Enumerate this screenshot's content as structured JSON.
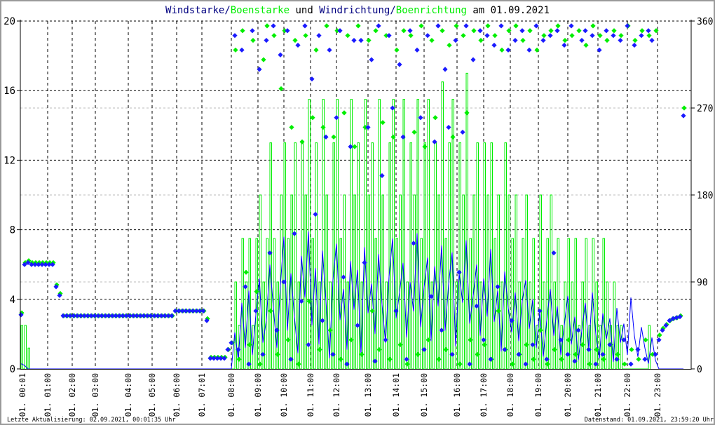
{
  "chart_data": {
    "type": "line+scatter",
    "title_parts": [
      {
        "text": "Windstarke/",
        "color": "#000080"
      },
      {
        "text": "Boenstarke",
        "color": "#00ee00"
      },
      {
        "text": " und ",
        "color": "#000000"
      },
      {
        "text": "Windrichtung/",
        "color": "#000080"
      },
      {
        "text": "Boenrichtung",
        "color": "#00ee00"
      },
      {
        "text": " am 01.09.2021",
        "color": "#000000"
      }
    ],
    "x_range": [
      0,
      190
    ],
    "y_left": {
      "range": [
        0,
        20
      ],
      "ticks": [
        "0",
        "4",
        "8",
        "12",
        "16",
        "20"
      ],
      "values": [
        0,
        4,
        8,
        12,
        16,
        20
      ]
    },
    "y_right": {
      "range": [
        0,
        360
      ],
      "ticks": [
        "0",
        "90",
        "180",
        "270",
        "360"
      ],
      "values": [
        0,
        90,
        180,
        270,
        360
      ]
    },
    "x_ticks": [
      {
        "label": "01. 00:01",
        "index": 0.4
      },
      {
        "label": "01. 01:00",
        "index": 7.6
      },
      {
        "label": "01. 02:00",
        "index": 14.6
      },
      {
        "label": "01. 03:00",
        "index": 21.2
      },
      {
        "label": "01. 04:00",
        "index": 30.6
      },
      {
        "label": "01. 05:00",
        "index": 37.4
      },
      {
        "label": "01. 06:00",
        "index": 44.4
      },
      {
        "label": "01. 07:01",
        "index": 51.6
      },
      {
        "label": "01. 08:00",
        "index": 60
      },
      {
        "label": "01. 09:00",
        "index": 67.6
      },
      {
        "label": "01. 10:00",
        "index": 75
      },
      {
        "label": "01. 11:00",
        "index": 82.6
      },
      {
        "label": "01. 12:00",
        "index": 90
      },
      {
        "label": "01. 13:00",
        "index": 99
      },
      {
        "label": "01. 14:01",
        "index": 107
      },
      {
        "label": "01. 15:00",
        "index": 115
      },
      {
        "label": "01. 16:00",
        "index": 124.4
      },
      {
        "label": "01. 17:00",
        "index": 132
      },
      {
        "label": "01. 18:00",
        "index": 139.6
      },
      {
        "label": "01. 19:00",
        "index": 147.6
      },
      {
        "label": "01. 20:00",
        "index": 156
      },
      {
        "label": "01. 21:00",
        "index": 164.6
      },
      {
        "label": "01. 22:00",
        "index": 173
      },
      {
        "label": "01. 23:00",
        "index": 181.6
      }
    ],
    "series": [
      {
        "name": "Windstarke",
        "axis": "left",
        "kind": "line",
        "color": "#0000ff",
        "values": [
          0.3,
          0.2,
          0,
          0,
          0,
          0,
          0,
          0,
          0,
          0,
          0,
          0,
          0,
          0,
          0,
          0,
          0,
          0,
          0,
          0,
          0,
          0,
          0,
          0,
          0,
          0,
          0,
          0,
          0,
          0,
          0,
          0,
          0,
          0,
          0,
          0,
          0,
          0,
          0,
          0,
          0,
          0,
          0,
          0,
          0,
          0,
          0,
          0,
          0,
          0,
          0,
          0,
          0,
          0,
          0,
          0,
          0,
          0,
          0,
          0,
          0,
          2.1,
          0.5,
          3.8,
          1.2,
          4.5,
          0.8,
          3.1,
          5.2,
          1.5,
          2.8,
          6.0,
          3.5,
          1.2,
          4.8,
          7.6,
          2.2,
          5.5,
          3.0,
          0.9,
          6.5,
          4.1,
          7.9,
          2.5,
          5.8,
          1.4,
          6.8,
          3.9,
          0.6,
          5.1,
          7.2,
          2.8,
          4.6,
          1.1,
          6.2,
          3.4,
          5.7,
          0.8,
          7.0,
          3.2,
          4.9,
          2.0,
          6.6,
          3.7,
          1.5,
          5.3,
          7.5,
          2.9,
          4.4,
          6.1,
          1.8,
          5.0,
          3.3,
          7.8,
          2.4,
          4.7,
          6.4,
          1.6,
          5.9,
          3.6,
          7.1,
          2.2,
          4.9,
          6.7,
          1.3,
          5.5,
          3.8,
          7.4,
          2.6,
          4.2,
          6.0,
          1.9,
          5.2,
          3.0,
          6.9,
          2.7,
          4.5,
          1.0,
          5.6,
          3.5,
          2.1,
          4.4,
          1.6,
          3.9,
          5.1,
          2.3,
          4.0,
          1.2,
          3.3,
          0.7,
          2.8,
          4.6,
          1.9,
          3.6,
          0.8,
          2.5,
          4.2,
          1.4,
          3.0,
          0.5,
          2.2,
          3.8,
          1.1,
          4.4,
          2.0,
          0.6,
          3.2,
          1.7,
          2.9,
          0.4,
          3.5,
          1.5,
          2.6,
          0.8,
          4.1,
          1.9,
          0.7,
          2.4,
          1.2,
          0.3,
          1.8,
          0.5,
          0,
          0,
          0,
          0,
          0,
          0,
          0,
          0
        ]
      },
      {
        "name": "Boenstarke",
        "axis": "left",
        "kind": "step",
        "color": "#00ee00",
        "values": [
          2.5,
          2.5,
          1.2,
          0,
          0,
          0,
          0,
          0,
          0,
          0,
          0,
          0,
          0,
          0,
          0,
          0,
          0,
          0,
          0,
          0,
          0,
          0,
          0,
          0,
          0,
          0,
          0,
          0,
          0,
          0,
          0,
          0,
          0,
          0,
          0,
          0,
          0,
          0,
          0,
          0,
          0,
          0,
          0,
          0,
          0,
          0,
          0,
          0,
          0,
          0,
          0,
          0,
          0,
          0,
          0,
          0,
          0,
          0,
          0,
          0,
          0,
          5.0,
          2.5,
          7.5,
          5.0,
          7.5,
          2.5,
          7.5,
          10.0,
          5.0,
          7.5,
          13.0,
          7.5,
          5.0,
          10.0,
          13.0,
          7.5,
          10.0,
          13.0,
          5.0,
          13.0,
          10.0,
          15.5,
          7.5,
          13.0,
          5.0,
          15.5,
          10.0,
          5.0,
          13.0,
          15.5,
          7.5,
          10.0,
          5.0,
          15.5,
          10.0,
          13.0,
          5.0,
          15.5,
          10.0,
          13.0,
          7.5,
          15.5,
          10.0,
          5.0,
          13.0,
          15.5,
          7.5,
          10.0,
          15.5,
          5.0,
          13.0,
          10.0,
          15.5,
          7.5,
          13.0,
          15.5,
          5.0,
          13.0,
          10.0,
          16.5,
          7.5,
          13.0,
          15.5,
          5.0,
          13.0,
          10.0,
          17.0,
          7.5,
          10.0,
          13.0,
          5.0,
          13.0,
          10.0,
          13.0,
          7.5,
          10.0,
          5.0,
          13.0,
          10.0,
          7.5,
          10.0,
          5.0,
          7.5,
          10.0,
          5.0,
          7.5,
          2.5,
          10.0,
          5.0,
          7.5,
          10.0,
          5.0,
          7.5,
          2.5,
          5.0,
          7.5,
          5.0,
          7.5,
          2.5,
          5.0,
          7.5,
          2.5,
          7.5,
          5.0,
          2.5,
          7.5,
          5.0,
          2.5,
          5.0,
          2.5,
          2.5,
          0,
          0,
          0,
          0,
          0,
          0,
          0,
          2.5
        ]
      },
      {
        "name": "Boenrichtung",
        "axis": "right",
        "kind": "scatter",
        "color": "#00ee00",
        "values": [
          58,
          110,
          112,
          110,
          110,
          110,
          110,
          110,
          110,
          110,
          87,
          78,
          55,
          55,
          55,
          55,
          55,
          55,
          55,
          55,
          55,
          55,
          55,
          55,
          55,
          55,
          55,
          55,
          55,
          55,
          55,
          55,
          55,
          55,
          55,
          55,
          55,
          55,
          55,
          55,
          55,
          55,
          55,
          55,
          60,
          60,
          60,
          60,
          60,
          60,
          60,
          60,
          60,
          52,
          12,
          12,
          12,
          12,
          12,
          20,
          27,
          330,
          10,
          350,
          100,
          25,
          340,
          80,
          5,
          320,
          355,
          60,
          345,
          15,
          290,
          350,
          30,
          250,
          340,
          5,
          235,
          345,
          70,
          260,
          330,
          20,
          250,
          355,
          40,
          240,
          350,
          10,
          265,
          345,
          30,
          230,
          355,
          15,
          250,
          340,
          60,
          350,
          20,
          255,
          345,
          10,
          240,
          330,
          25,
          350,
          5,
          345,
          245,
          15,
          355,
          230,
          30,
          340,
          260,
          10,
          350,
          20,
          335,
          240,
          355,
          5,
          345,
          265,
          30,
          350,
          15,
          340,
          25,
          355,
          10,
          345,
          60,
          330,
          20,
          350,
          5,
          355,
          15,
          340,
          25,
          350,
          10,
          330,
          40,
          345,
          5,
          350,
          20,
          355,
          10,
          340,
          30,
          345,
          15,
          350,
          25,
          335,
          5,
          355,
          20,
          345,
          10,
          340,
          25,
          350,
          15,
          345,
          5,
          355,
          20,
          340,
          10,
          350,
          30,
          345,
          15,
          350,
          35,
          42,
          46,
          50,
          52,
          53,
          55,
          270
        ]
      },
      {
        "name": "Windrichtung",
        "axis": "right",
        "kind": "scatter",
        "color": "#1a1aff",
        "values": [
          56,
          108,
          110,
          108,
          108,
          108,
          108,
          108,
          108,
          108,
          85,
          76,
          55,
          55,
          55,
          55,
          55,
          55,
          55,
          55,
          55,
          55,
          55,
          55,
          55,
          55,
          55,
          55,
          55,
          55,
          55,
          55,
          55,
          55,
          55,
          55,
          55,
          55,
          55,
          55,
          55,
          55,
          55,
          55,
          60,
          60,
          60,
          60,
          60,
          60,
          60,
          60,
          60,
          50,
          11,
          11,
          11,
          11,
          11,
          20,
          27,
          345,
          20,
          330,
          85,
          5,
          350,
          60,
          310,
          15,
          340,
          120,
          355,
          40,
          325,
          90,
          350,
          10,
          140,
          335,
          70,
          355,
          25,
          300,
          160,
          345,
          50,
          240,
          330,
          15,
          260,
          350,
          95,
          5,
          230,
          340,
          45,
          340,
          110,
          250,
          320,
          8,
          355,
          200,
          30,
          345,
          270,
          60,
          315,
          240,
          10,
          350,
          130,
          330,
          260,
          20,
          345,
          75,
          235,
          355,
          40,
          310,
          250,
          15,
          340,
          100,
          245,
          355,
          5,
          320,
          65,
          350,
          30,
          345,
          10,
          335,
          85,
          355,
          20,
          330,
          50,
          340,
          15,
          350,
          5,
          330,
          25,
          355,
          60,
          340,
          10,
          345,
          120,
          350,
          30,
          335,
          15,
          355,
          8,
          40,
          340,
          350,
          20,
          345,
          5,
          330,
          15,
          350,
          25,
          345,
          10,
          340,
          30,
          355,
          5,
          335,
          20,
          345,
          10,
          350,
          340,
          15,
          30,
          40,
          45,
          50,
          52,
          53,
          54,
          262
        ]
      }
    ],
    "grid": true,
    "legend": "title"
  },
  "footer": {
    "left": "Letzte Aktualisierung: 02.09.2021, 00:01:35 Uhr",
    "right": "Datenstand: 01.09.2021, 23:59:20 Uhr"
  }
}
